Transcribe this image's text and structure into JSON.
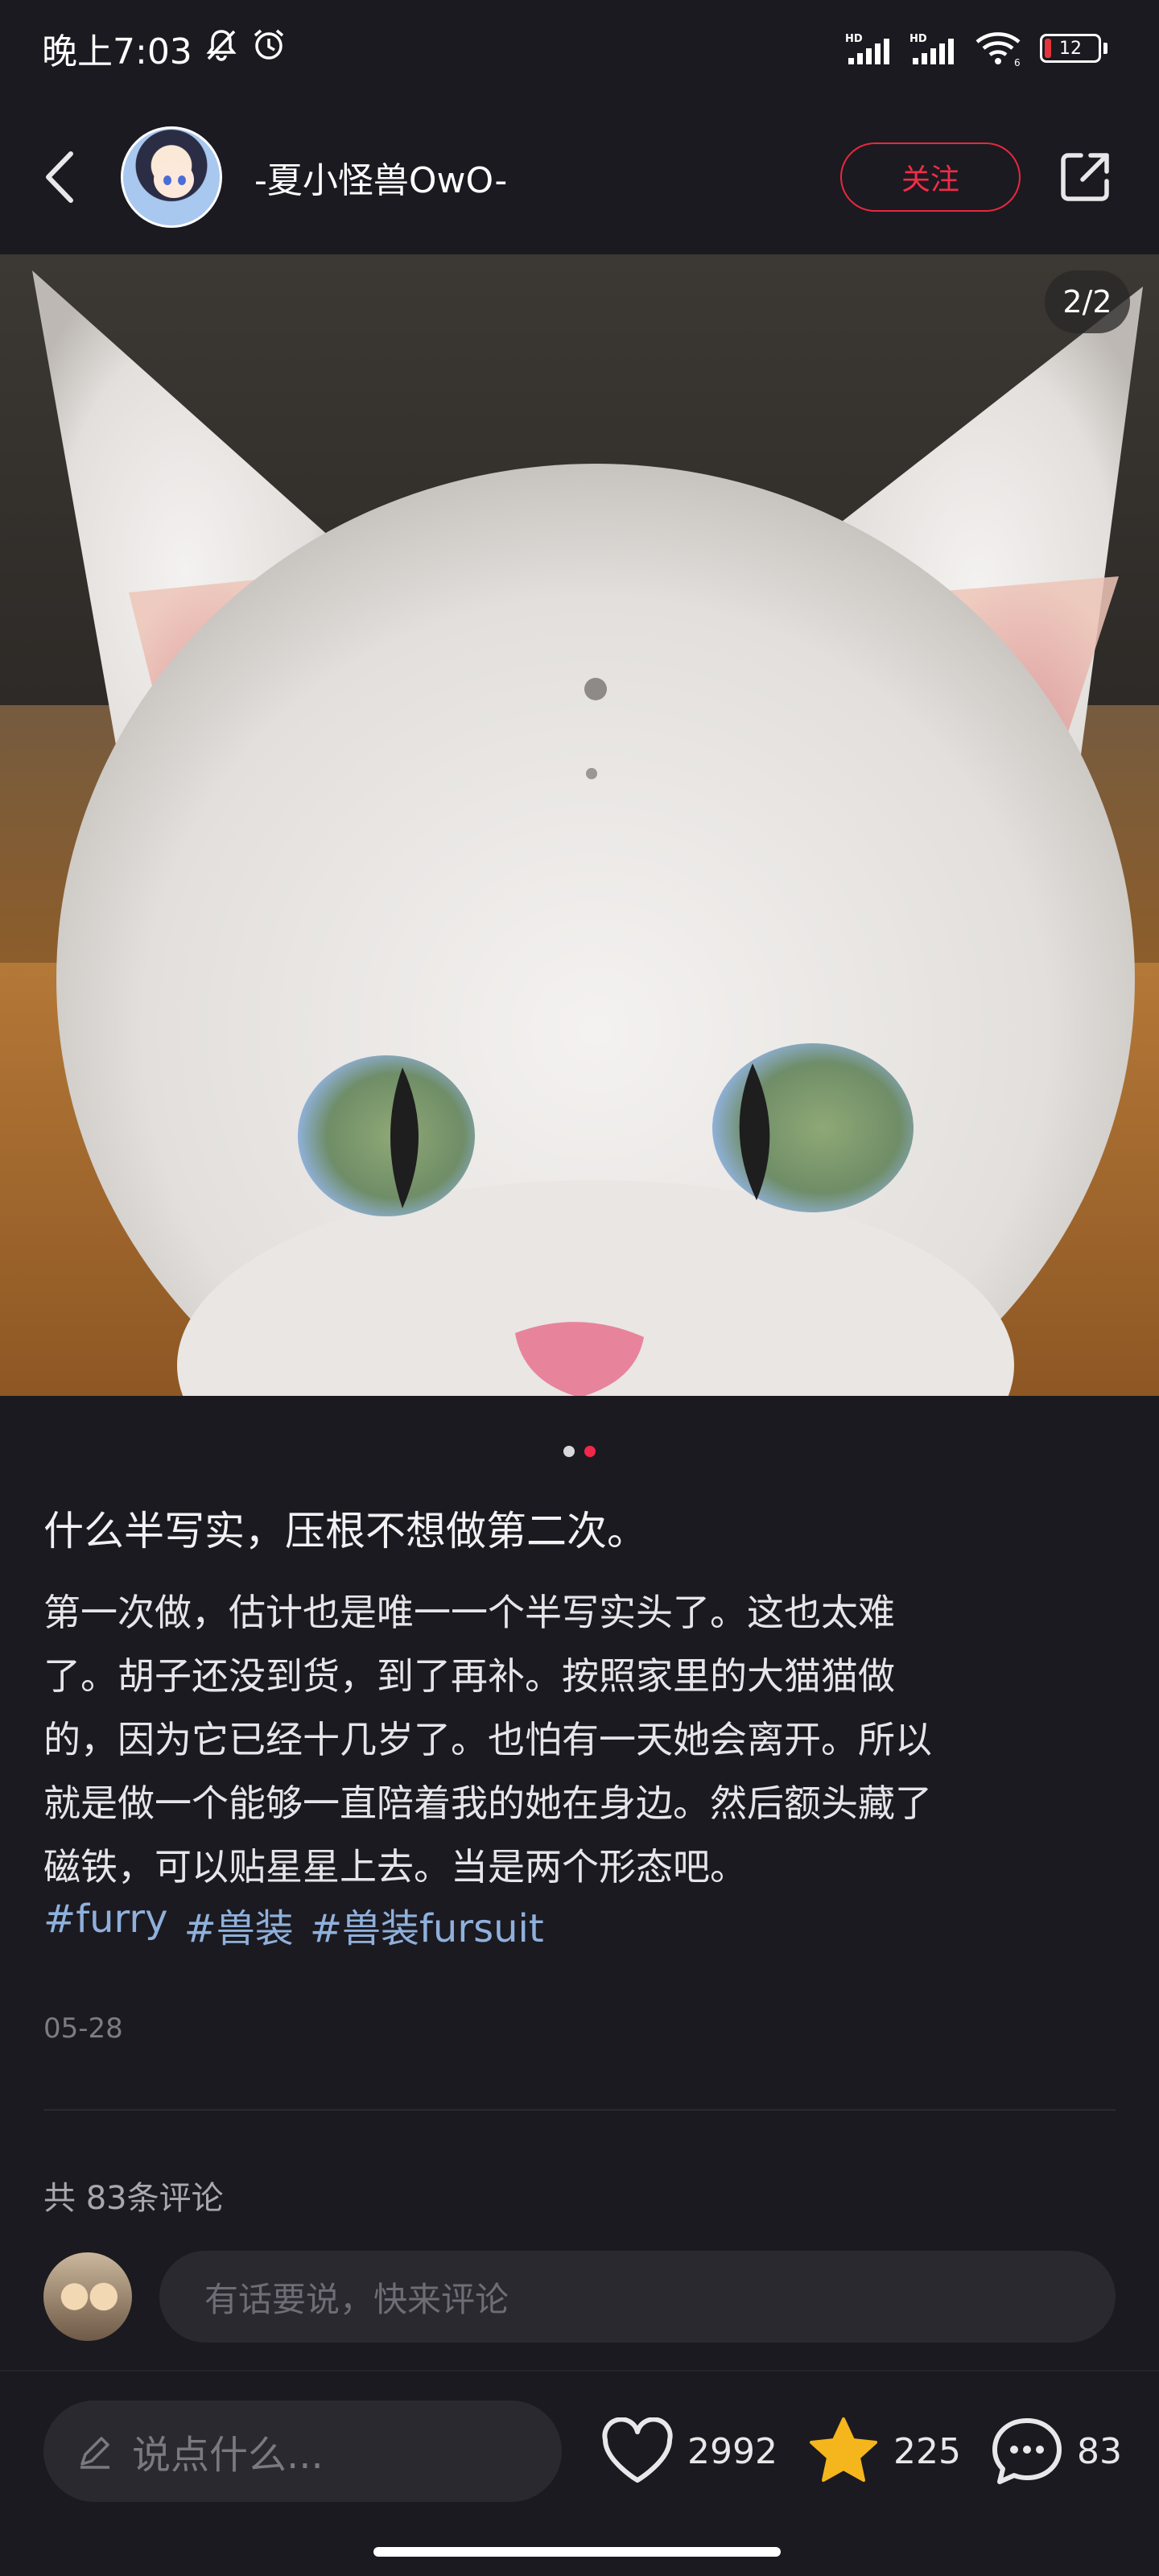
{
  "status_bar": {
    "time": "晚上7:03",
    "network_1": "HD",
    "network_2": "HD",
    "wifi_gen": "6",
    "battery": "12"
  },
  "header": {
    "username": "-夏小怪兽OwO-",
    "follow_label": "关注"
  },
  "photo": {
    "page_counter": "2/2"
  },
  "post": {
    "title": "什么半写实，压根不想做第二次。",
    "body_lines": [
      "第一次做，估计也是唯一一个半写实头了。这也太难",
      "了。胡子还没到货，到了再补。按照家里的大猫猫做",
      "的，因为它已经十几岁了。也怕有一天她会离开。所以",
      "就是做一个能够一直陪着我的她在身边。然后额头藏了",
      "磁铁，可以贴星星上去。当是两个形态吧。"
    ],
    "tags": [
      "#furry",
      "#兽装",
      "#兽装fursuit"
    ],
    "date": "05-28"
  },
  "comments": {
    "count_label": "共 83条评论",
    "input_placeholder": "有话要说，快来评论"
  },
  "bottom_bar": {
    "say_placeholder": "说点什么...",
    "likes": "2992",
    "stars": "225",
    "comments": "83"
  },
  "colors": {
    "accent": "#f0284a",
    "tag": "#8fb0dc",
    "background": "#1b1a20"
  }
}
